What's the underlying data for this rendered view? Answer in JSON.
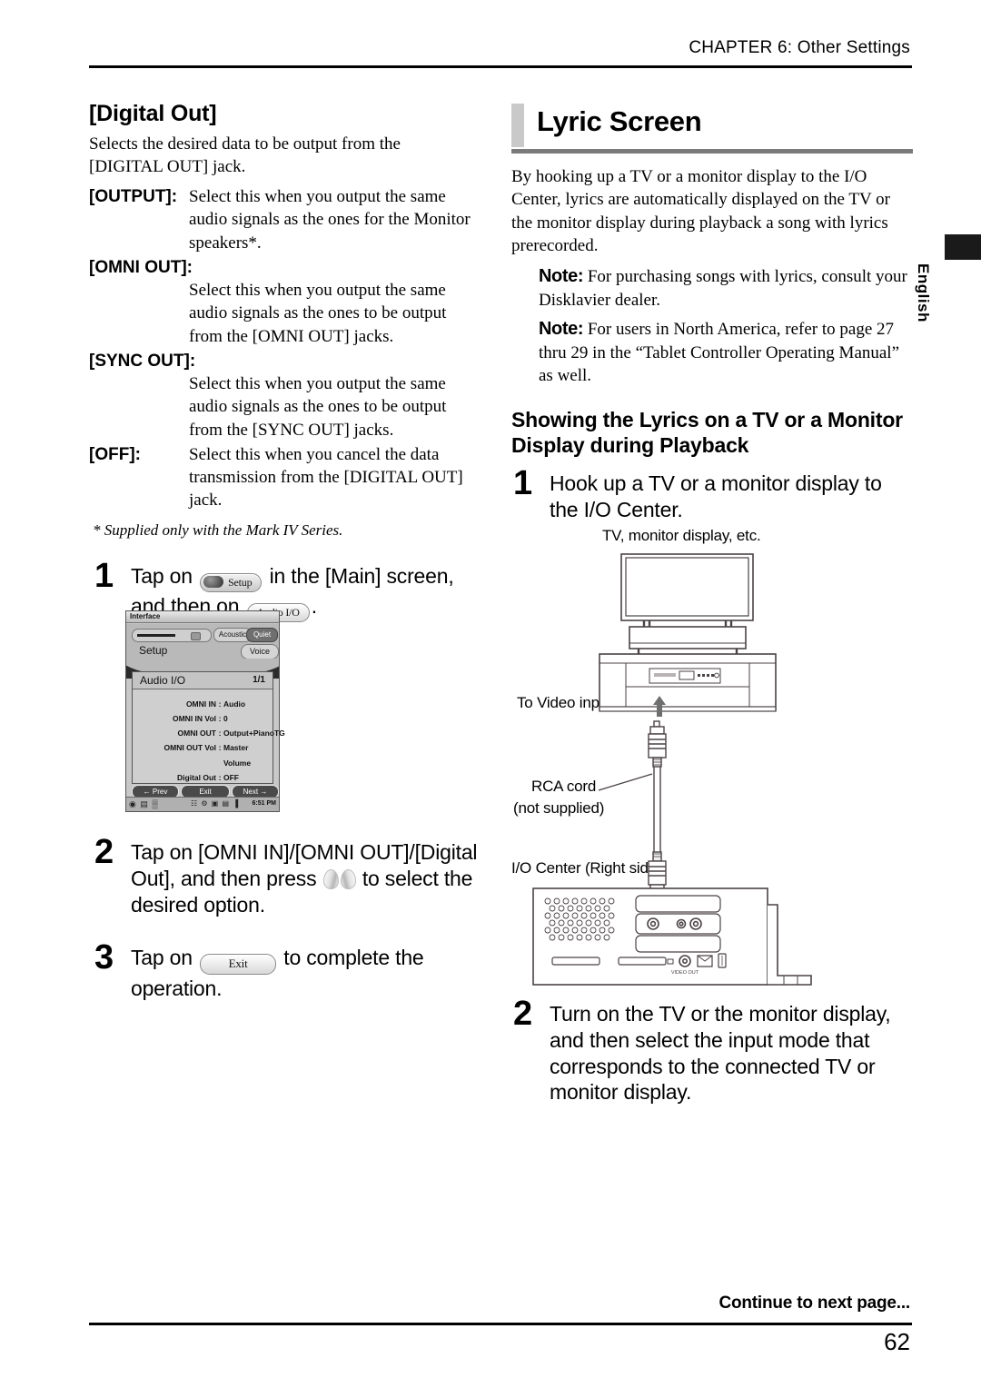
{
  "header": {
    "chapter": "CHAPTER 6: Other Settings"
  },
  "side_tab": {
    "label": "English"
  },
  "left_column": {
    "heading": "[Digital Out]",
    "intro": "Selects the desired data to be output from the [DIGITAL OUT] jack.",
    "definitions": [
      {
        "term": "[OUTPUT]:",
        "inline": true,
        "body": "Select this when you output the same audio signals as the ones for the Monitor speakers*."
      },
      {
        "term": "[OMNI OUT]:",
        "inline": false,
        "body": "Select this when you output the same audio signals as the ones to be output from the [OMNI OUT] jacks."
      },
      {
        "term": "[SYNC OUT]:",
        "inline": false,
        "body": "Select this when you output the same audio signals as the ones to be output from the [SYNC OUT] jacks."
      },
      {
        "term": "[OFF]:",
        "inline": true,
        "body": "Select this when you cancel the data transmission from the [DIGITAL OUT] jack."
      }
    ],
    "footnote": "* Supplied only with the Mark IV Series.",
    "steps": [
      {
        "number": "1",
        "part1": "Tap on",
        "button1": "Setup",
        "part2": "in the [Main] screen, and then on",
        "button2": "Audio I/O",
        "part3": "."
      },
      {
        "number": "2",
        "part1": "Tap on [OMNI IN]/[OMNI OUT]/[Digital Out], and then press",
        "part2": "to select the desired option."
      },
      {
        "number": "3",
        "part1": "Tap on",
        "button1": "Exit",
        "part2": "to complete the operation."
      }
    ]
  },
  "tablet_screenshot": {
    "window_title": "Interface",
    "close_icon": "✕",
    "acoustic_label": "Acoustic",
    "quiet_label": "Quiet",
    "setup_label": "Setup",
    "voice_label": "Voice",
    "panel_title": "Audio I/O",
    "panel_page": "1/1",
    "rows": [
      {
        "key": "OMNI IN",
        "sep": ":",
        "value": "Audio"
      },
      {
        "key": "OMNI IN Vol",
        "sep": ":",
        "value": "0"
      },
      {
        "key": "OMNI OUT",
        "sep": ":",
        "value": "Output+PianoTG"
      },
      {
        "key": "OMNI OUT Vol",
        "sep": ":",
        "value": "Master Volume"
      },
      {
        "key": "Digital Out",
        "sep": ":",
        "value": "OFF"
      }
    ],
    "nav_prev": "← Prev",
    "nav_exit": "Exit",
    "nav_next": "Next →",
    "tray_left": "◉ ▤ ▒",
    "tray_icons": "☷ ⚙ ▣ ▤ ▐",
    "tray_time": "6:51 PM"
  },
  "right_column": {
    "heading": "Lyric Screen",
    "intro": "By hooking up a TV or a monitor display to the I/O Center, lyrics are automatically displayed on the TV or the monitor display during playback a song with lyrics prerecorded.",
    "notes": [
      {
        "label": "Note:",
        "text": " For purchasing songs with lyrics, consult your Disklavier dealer."
      },
      {
        "label": "Note:",
        "text": " For users in North America, refer to page 27 thru 29 in the “Tablet Controller Operating Manual” as well."
      }
    ],
    "section_heading": "Showing the Lyrics on a TV or a Monitor Display during Playback",
    "steps": [
      {
        "number": "1",
        "text": "Hook up a TV or a monitor display to the I/O Center."
      },
      {
        "number": "2",
        "text": "Turn on the TV or the monitor display, and then select the input mode that corresponds to the connected TV or monitor display."
      }
    ]
  },
  "diagram": {
    "caption_tv": "TV, monitor display, etc.",
    "caption_video_input": "To Video input",
    "caption_rca_line1": "RCA cord",
    "caption_rca_line2": "(not supplied)",
    "caption_io_center": "I/O Center (Right side)",
    "port_label": "VIDEO OUT"
  },
  "footer": {
    "continue": "Continue to next page...",
    "page_number": "62"
  },
  "colors": {
    "rule": "#000000",
    "heading_bar": "#c9c9c9",
    "heading_rule": "#7a7a7a",
    "diagram_line": "#4a4246"
  }
}
